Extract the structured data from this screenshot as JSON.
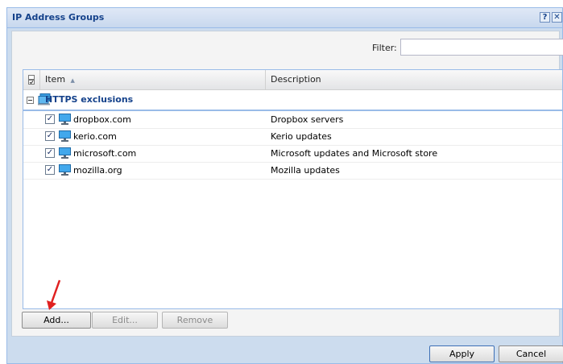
{
  "dialog": {
    "title": "IP Address Groups",
    "help_glyph": "?",
    "close_glyph": "✕"
  },
  "filter": {
    "label": "Filter:",
    "value": ""
  },
  "grid": {
    "columns": {
      "item": "Item",
      "description": "Description"
    },
    "sort_indicator": "▲",
    "group": {
      "name": "HTTPS exclusions",
      "expanded": true
    },
    "rows": [
      {
        "item": "dropbox.com",
        "description": "Dropbox servers",
        "checked": true
      },
      {
        "item": "kerio.com",
        "description": "Kerio updates",
        "checked": true
      },
      {
        "item": "microsoft.com",
        "description": "Microsoft updates and Microsoft store",
        "checked": true
      },
      {
        "item": "mozilla.org",
        "description": "Mozilla updates",
        "checked": true
      }
    ]
  },
  "buttons": {
    "add": "Add...",
    "edit": "Edit...",
    "remove": "Remove",
    "apply": "Apply",
    "cancel": "Cancel"
  },
  "colors": {
    "title_text": "#15428b",
    "annotation_arrow": "#e02020"
  },
  "icons": {
    "row_icon": "computer-monitor-icon",
    "group_icon": "network-group-icon",
    "annotation": "red-arrow-icon"
  }
}
